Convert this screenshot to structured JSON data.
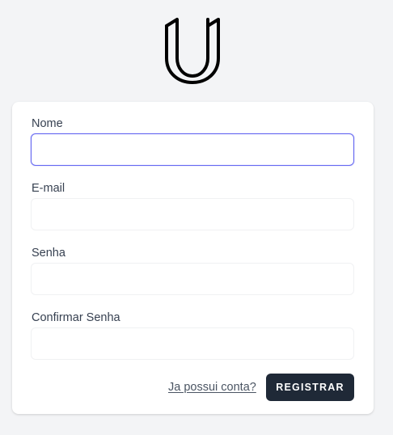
{
  "logo": {
    "icon": "u-logo-icon"
  },
  "form": {
    "fields": [
      {
        "label": "Nome",
        "value": "",
        "placeholder": "",
        "focused": true
      },
      {
        "label": "E-mail",
        "value": "",
        "placeholder": ""
      },
      {
        "label": "Senha",
        "value": "",
        "placeholder": ""
      },
      {
        "label": "Confirmar Senha",
        "value": "",
        "placeholder": ""
      }
    ],
    "login_link": "Ja possui conta?",
    "submit_label": "REGISTRAR"
  },
  "colors": {
    "background": "#f3f4f6",
    "card": "#ffffff",
    "focus_ring": "#6366f1",
    "button": "#1f2937",
    "button_text": "#ffffff",
    "label_text": "#374151"
  }
}
